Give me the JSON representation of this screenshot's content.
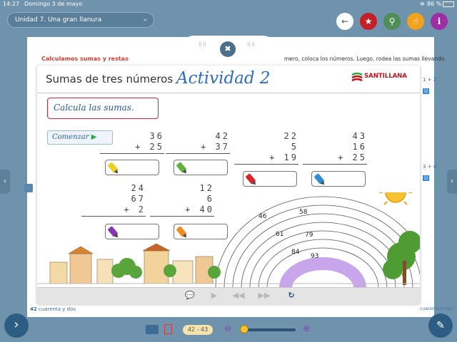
{
  "status_bar": {
    "time": "14:27",
    "date": "Domingo 3 de mayo",
    "battery": "86 %"
  },
  "toolbar": {
    "unit_title": "Unidad 7. Una gran llanura",
    "buttons": [
      {
        "name": "back",
        "color": "#ffffff",
        "glyph": "🡐"
      },
      {
        "name": "star",
        "color": "#c3202a",
        "glyph": "★"
      },
      {
        "name": "search",
        "color": "#4f8f55",
        "glyph": "⚲"
      },
      {
        "name": "hand",
        "color": "#f0a21c",
        "glyph": "☝"
      },
      {
        "name": "info",
        "color": "#9c2fa2",
        "glyph": "i"
      }
    ]
  },
  "book_page": {
    "title": "Calculamos sumas y restas",
    "text": "mero, coloca los números. Luego, rodea las sumas llevando.",
    "page_number": "42",
    "footer_left": "cuarenta y dos",
    "footer_right": "cuarenta y tres",
    "side_labels": [
      "1 + 2",
      "U",
      "3 + 4",
      "U"
    ]
  },
  "activity": {
    "title": "Sumas de tres números",
    "cursive": "Actividad 2",
    "logo": "SANTILLANA",
    "instruction": "Calcula las sumas.",
    "start_label": "Comenzar",
    "sums": [
      {
        "rows": [
          "36",
          "+ 25",
          ""
        ],
        "crayon": "#f2d021"
      },
      {
        "rows": [
          "42",
          "+ 37",
          ""
        ],
        "crayon": "#5cb53a"
      },
      {
        "rows": [
          "22",
          "5",
          "+ 19"
        ],
        "crayon": "#d8262b"
      },
      {
        "rows": [
          "43",
          "16",
          "+ 25"
        ],
        "crayon": "#2f8fd4"
      },
      {
        "rows": [
          "24",
          "67",
          "+ 2"
        ],
        "crayon": "#8a35b5"
      },
      {
        "rows": [
          "12",
          "6",
          "+ 40"
        ],
        "crayon": "#f08a1d"
      }
    ],
    "rainbow_numbers": [
      "46",
      "58",
      "61",
      "79",
      "84",
      "93"
    ]
  },
  "bottom_bar": {
    "page_range": "42 - 43"
  }
}
